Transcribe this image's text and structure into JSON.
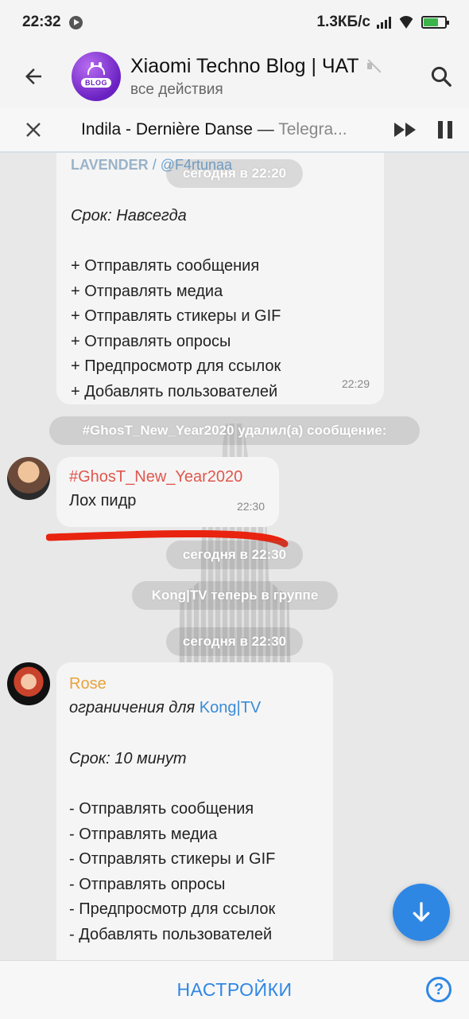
{
  "status_bar": {
    "time": "22:32",
    "net_speed": "1.3КБ/с",
    "battery_accent": "#3bb54a"
  },
  "header": {
    "back_icon": "arrow-left-icon",
    "avatar_text": "BLOG",
    "title": "Xiaomi Techno Blog | ЧАТ",
    "subtitle": "все действия",
    "search_icon": "search-icon"
  },
  "player": {
    "track_title": "Indila - Dernière Danse",
    "separator": "—",
    "source": "Telegra..."
  },
  "messages": {
    "m1": {
      "cut_prefix": "LAVENDER",
      "cut_mention": "/ @F4rtunaa",
      "date_overlay": "сегодня в 22:20",
      "term": "Срок: Навсегда",
      "rights": [
        "+ Отправлять сообщения",
        "+ Отправлять медиа",
        "+ Отправлять стикеры и GIF",
        "+ Отправлять опросы",
        "+ Предпросмотр для ссылок",
        "+ Добавлять пользователей"
      ],
      "time": "22:29"
    },
    "deleted_notice": "#GhosT_New_Year2020 удалил(а) сообщение:",
    "m2": {
      "sender": "#GhosT_New_Year2020",
      "text": "Лох пидр",
      "time": "22:30"
    },
    "date1": "сегодня в 22:30",
    "joined_notice": "Kong|TV теперь в группе",
    "date2": "сегодня в 22:30",
    "m3": {
      "sender": "Rose",
      "restriction_prefix": "ограничения для",
      "restriction_user": "Kong|TV",
      "term": "Срок: 10 минут",
      "rights": [
        "- Отправлять сообщения",
        "- Отправлять медиа",
        "- Отправлять стикеры и GIF",
        "- Отправлять опросы",
        "- Предпросмотр для ссылок",
        "- Добавлять пользователей"
      ]
    }
  },
  "bottom_bar": {
    "settings_label": "НАСТРОЙКИ",
    "help_label": "?"
  },
  "colors": {
    "accent_blue": "#2f87e4",
    "sender_red": "#e0574d",
    "sender_rose": "#e8a23c",
    "annotation_red": "#e8230f"
  }
}
